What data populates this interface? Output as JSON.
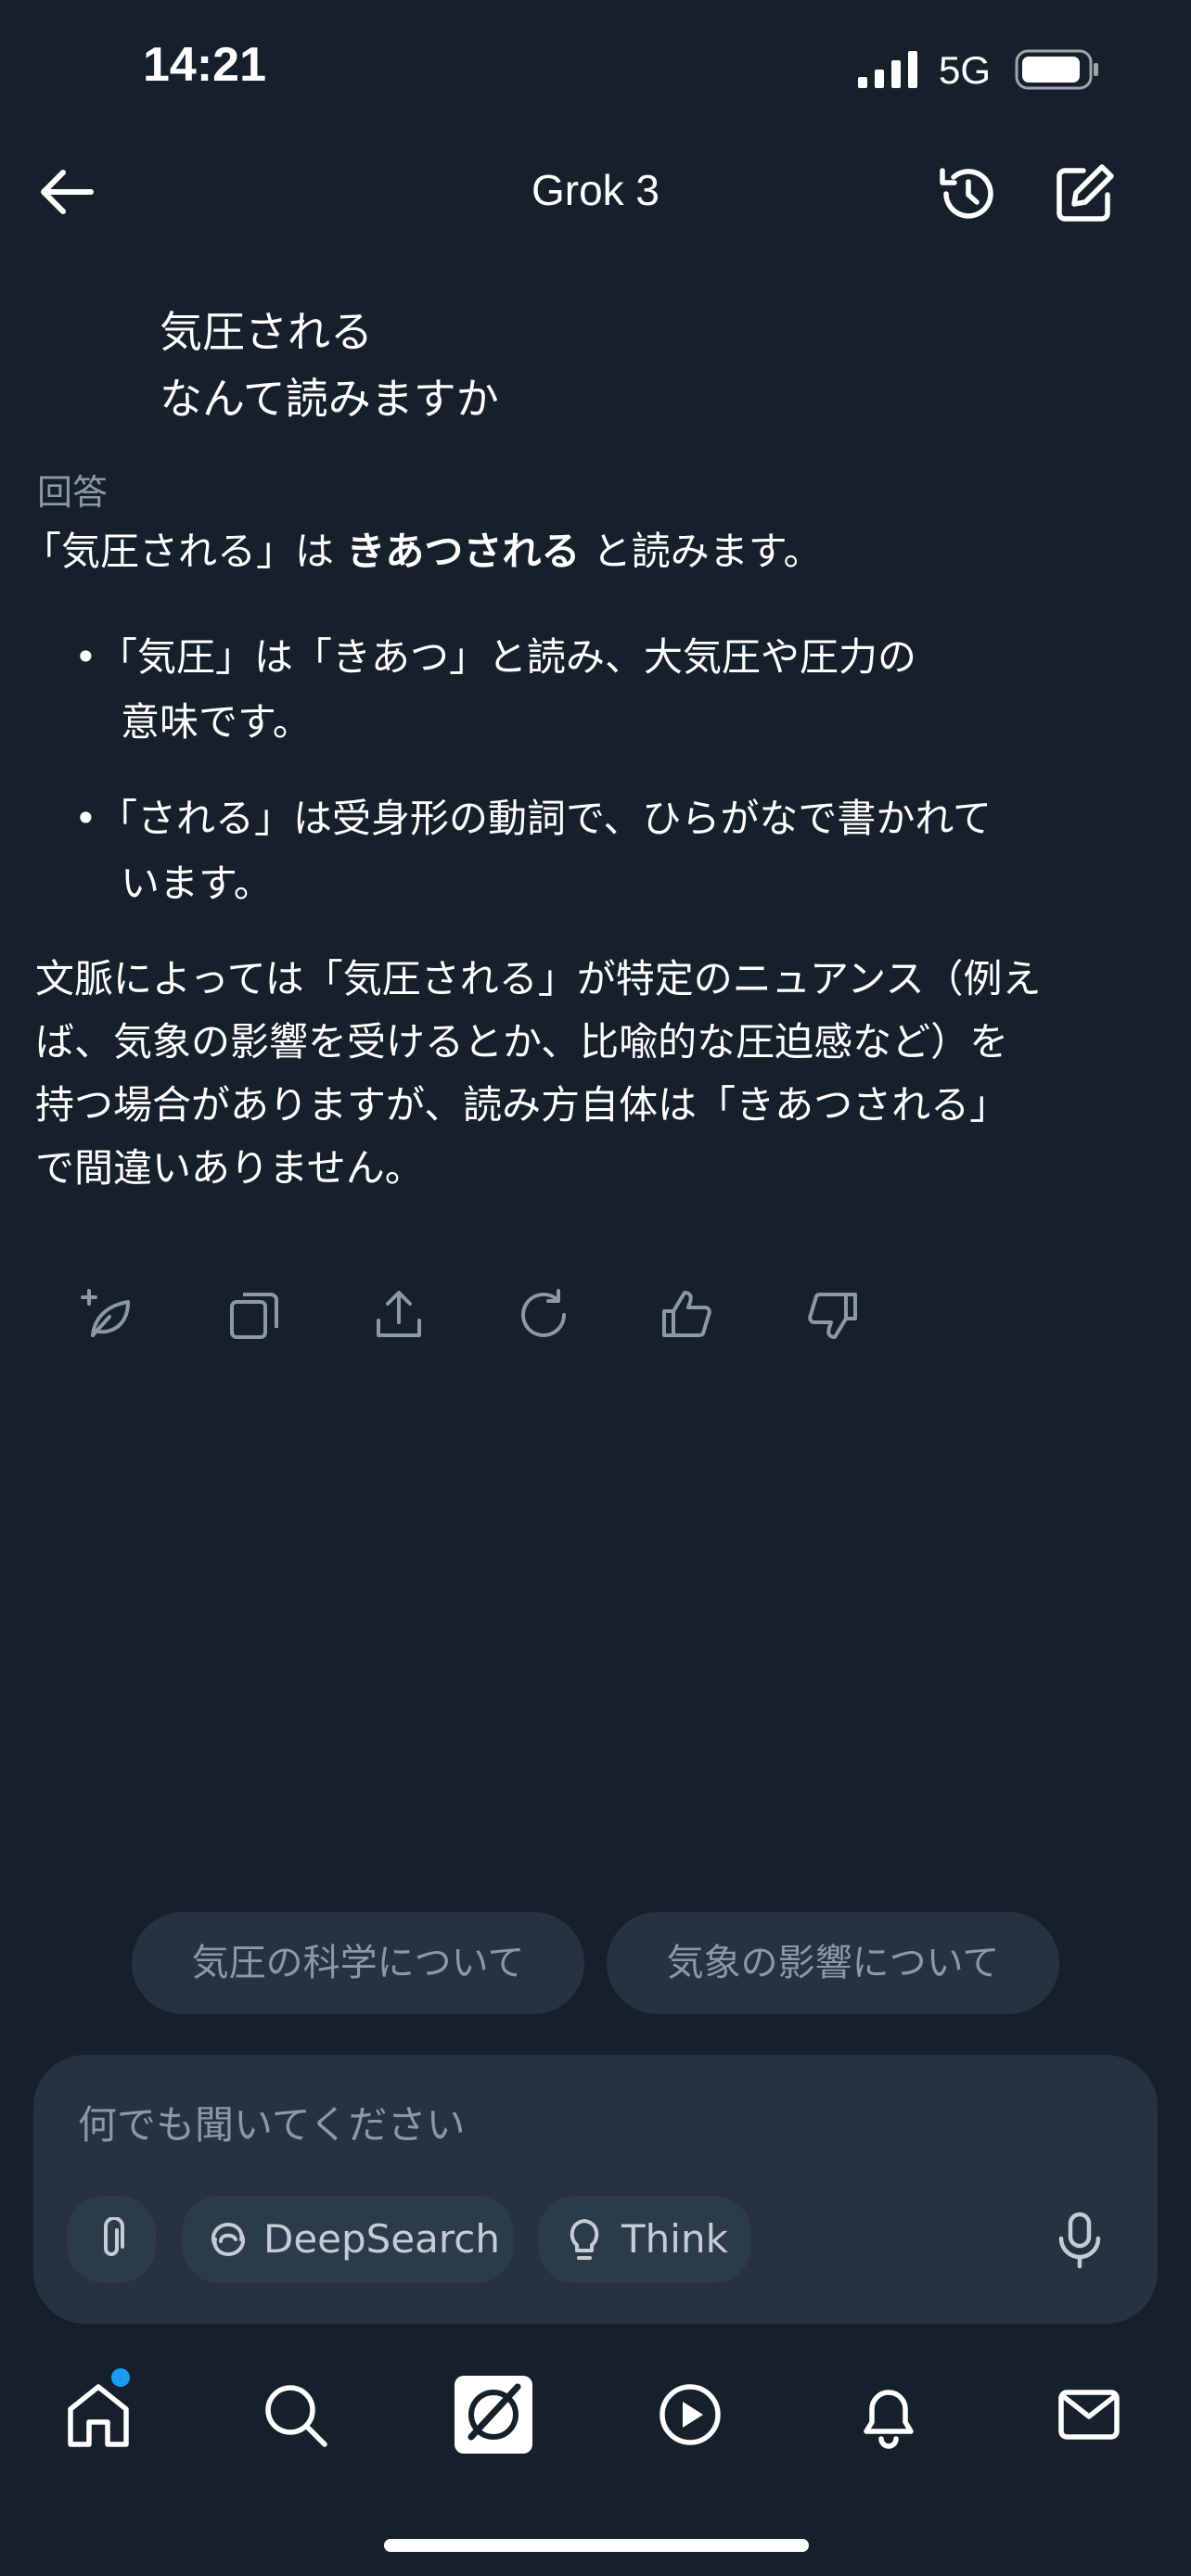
{
  "status_bar": {
    "time": "14:21",
    "network": "5G"
  },
  "header": {
    "title": "Grok 3"
  },
  "user_message": {
    "line1": "気圧される",
    "line2": "なんて読みますか"
  },
  "answer": {
    "label": "回答",
    "intro_pre": "「気圧される」は ",
    "intro_bold": "きあつされる",
    "intro_post": " と読みます。",
    "bullets": [
      {
        "line1": "「気圧」は「きあつ」と読み、大気圧や圧力の",
        "line2": "意味です。"
      },
      {
        "line1": "「される」は受身形の動詞で、ひらがなで書かれて",
        "line2": "います。"
      }
    ],
    "paragraph": [
      "文脈によっては「気圧される」が特定のニュアンス（例え",
      "ば、気象の影響を受けるとか、比喩的な圧迫感など）を",
      "持つ場合がありますが、読み方自体は「きあつされる」",
      "で間違いありません。"
    ]
  },
  "actions": [
    "sparkle-leaf-icon",
    "copy-icon",
    "share-icon",
    "regenerate-icon",
    "thumbs-up-icon",
    "thumbs-down-icon"
  ],
  "suggestions": [
    "気圧の科学について",
    "気象の影響について"
  ],
  "composer": {
    "placeholder": "何でも聞いてください",
    "deepsearch_label": "DeepSearch",
    "think_label": "Think"
  },
  "bottom_nav": [
    "home-icon",
    "search-icon",
    "grok-icon",
    "play-icon",
    "notifications-icon",
    "messages-icon"
  ],
  "colors": {
    "background": "#15202b",
    "surface": "#253341",
    "muted_text": "#8b98a5",
    "accent": "#1d9bf0"
  }
}
